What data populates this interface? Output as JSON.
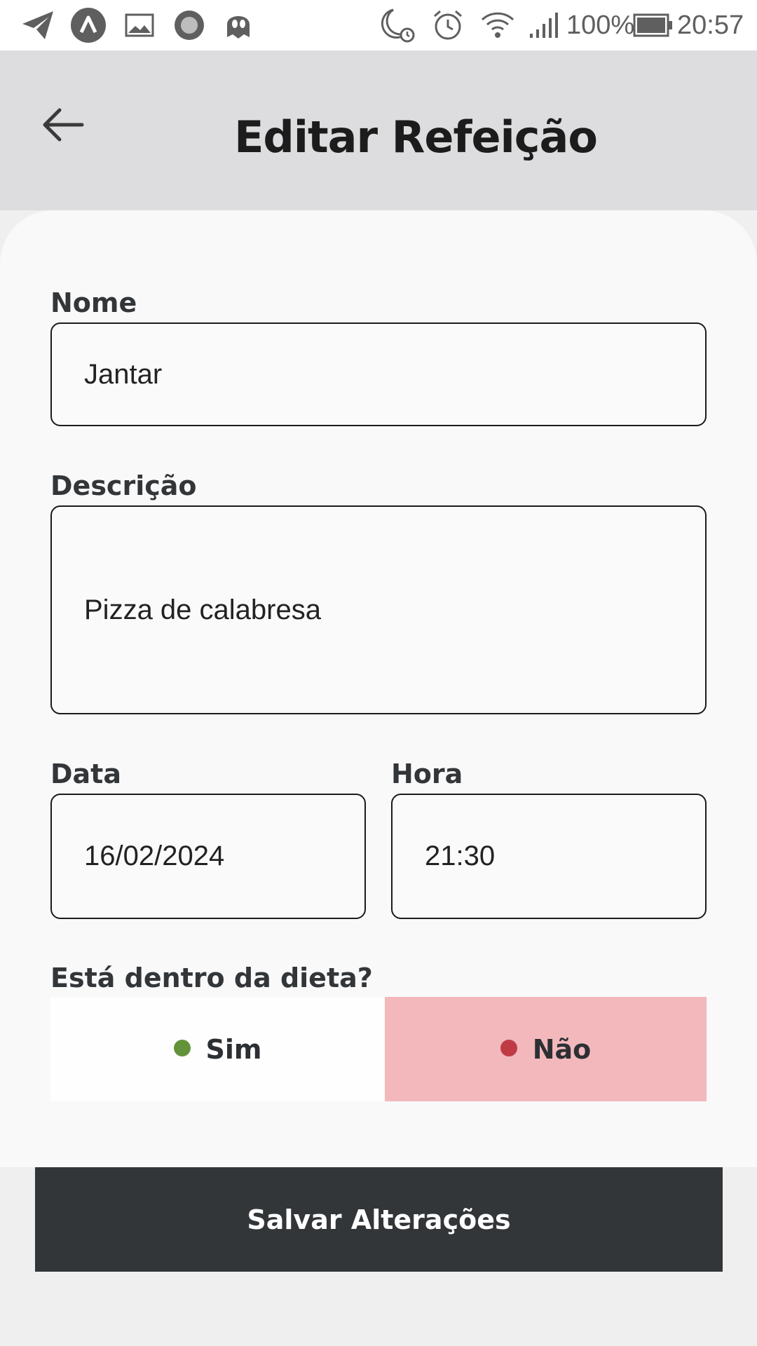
{
  "status_bar": {
    "icons": [
      "telegram-icon",
      "app-launcher-icon",
      "gallery-icon",
      "circle-app-icon",
      "ghost-icon",
      "do-not-disturb-icon",
      "alarm-icon",
      "wifi-icon",
      "cell-signal-icon",
      "battery-icon"
    ],
    "battery": "100%",
    "time": "20:57"
  },
  "header": {
    "back_icon": "arrow-left-icon",
    "title": "Editar Refeição"
  },
  "form": {
    "name": {
      "label": "Nome",
      "value": "Jantar"
    },
    "description": {
      "label": "Descrição",
      "value": "Pizza de calabresa"
    },
    "date": {
      "label": "Data",
      "value": "16/02/2024"
    },
    "time": {
      "label": "Hora",
      "value": "21:30"
    },
    "diet": {
      "question": "Está dentro da dieta?",
      "yes_label": "Sim",
      "no_label": "Não",
      "selected": "Não"
    }
  },
  "save_button": {
    "label": "Salvar Alterações"
  },
  "colors": {
    "header_bg": "#dddddf",
    "card_bg": "#f9f9f9",
    "yes_dot": "#639339",
    "no_dot": "#bf3b44",
    "no_selected_bg": "#f2b8bc",
    "button_bg": "#333639"
  }
}
